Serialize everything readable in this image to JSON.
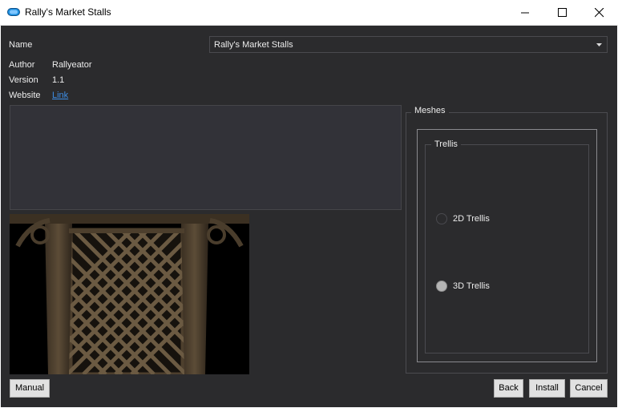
{
  "window": {
    "title": "Rally's Market Stalls"
  },
  "info": {
    "name_label": "Name",
    "name_value": "Rally's Market Stalls",
    "author_label": "Author",
    "author_value": "Rallyeator",
    "version_label": "Version",
    "version_value": "1.1",
    "website_label": "Website",
    "website_link": "Link"
  },
  "meshes": {
    "title": "Meshes",
    "group_title": "Trellis",
    "options": [
      {
        "label": "2D Trellis",
        "selected": false
      },
      {
        "label": "3D Trellis",
        "selected": true
      }
    ]
  },
  "buttons": {
    "manual": "Manual",
    "back": "Back",
    "install": "Install",
    "cancel": "Cancel"
  },
  "colors": {
    "background": "#2b2b2d",
    "link": "#3d8ee6",
    "app_icon": "#1e90e0"
  }
}
